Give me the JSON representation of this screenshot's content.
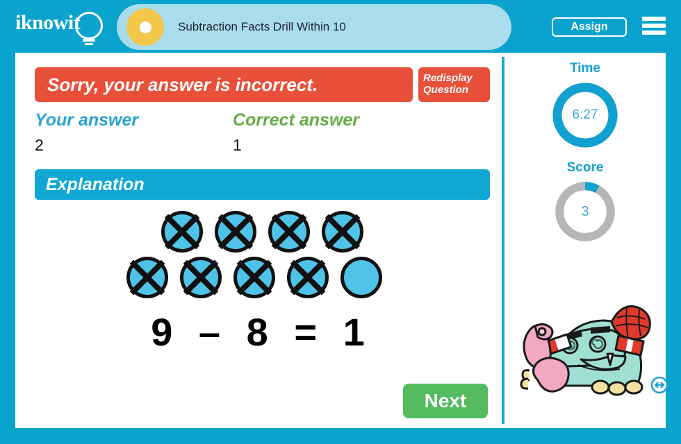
{
  "header": {
    "logo_text": "iknow",
    "logo_suffix": "it",
    "logo_icon": "lightbulb-icon",
    "dot_icon": "lesson-dot-icon",
    "title": "Subtraction Facts Drill Within 10",
    "assign_label": "Assign",
    "menu_icon": "hamburger-menu-icon",
    "bar_color": "#0aa3ce",
    "tab_color": "#a9dced",
    "dot_color": "#f2c84b"
  },
  "feedback": {
    "message": "Sorry, your answer is incorrect.",
    "banner_color": "#e8503a",
    "redisplay_line1": "Redisplay",
    "redisplay_line2": "Question"
  },
  "answers": {
    "your_label": "Your answer",
    "your_value": "2",
    "your_color": "#29a3d4",
    "correct_label": "Correct answer",
    "correct_value": "1",
    "correct_color": "#63ad45"
  },
  "explanation": {
    "title": "Explanation",
    "bar_color": "#11a7d4",
    "counter_fill": "#4fc3e8",
    "rows": [
      {
        "total": 4,
        "crossed": 4
      },
      {
        "total": 5,
        "crossed": 4
      }
    ],
    "equation": {
      "minuend": "9",
      "operator": "–",
      "subtrahend": "8",
      "equals": "=",
      "result": "1"
    }
  },
  "actions": {
    "next_label": "Next",
    "next_color": "#54bb5e"
  },
  "sidebar": {
    "time": {
      "title": "Time",
      "value": "6:27",
      "percent": 100,
      "ring_color": "#11a0d0",
      "track_color": "#11a0d0"
    },
    "score": {
      "title": "Score",
      "value": "3",
      "percent": 8,
      "ring_color": "#11a0d0",
      "track_color": "#b6b6b6"
    },
    "mascot_icon": "monster-mascot-icon",
    "resize_icon": "horizontal-resize-icon"
  }
}
